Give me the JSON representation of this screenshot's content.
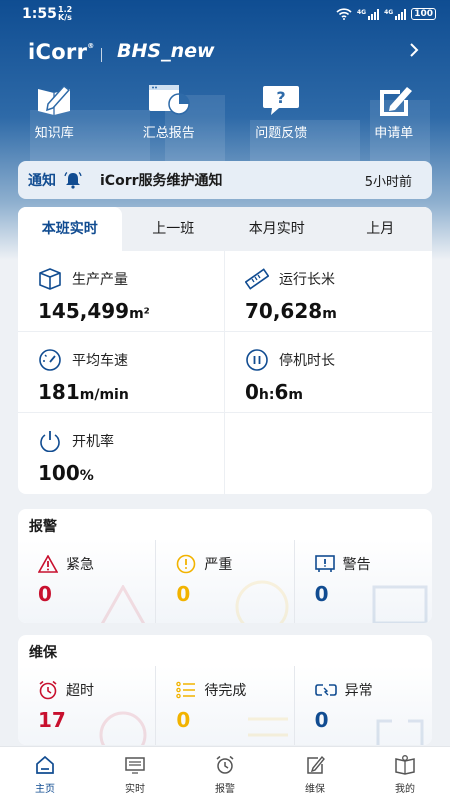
{
  "status_bar": {
    "time": "1:55",
    "net_speed_value": "1.2",
    "net_speed_unit": "K/s",
    "sim1": "4G",
    "sim2": "4G",
    "battery": "100"
  },
  "header": {
    "brand": "iCorr",
    "brand_mark": "®",
    "project": "BHS_new"
  },
  "quick_actions": [
    {
      "label": "知识库",
      "icon": "knowledge-base-icon"
    },
    {
      "label": "汇总报告",
      "icon": "report-chart-icon"
    },
    {
      "label": "问题反馈",
      "icon": "feedback-question-icon"
    },
    {
      "label": "申请单",
      "icon": "application-form-icon"
    }
  ],
  "notice": {
    "tag": "通知",
    "icon": "bell-icon",
    "text": "iCorr服务维护通知",
    "time": "5小时前"
  },
  "stats": {
    "tabs": [
      "本班实时",
      "上一班",
      "本月实时",
      "上月"
    ],
    "active_tab": 0,
    "items": [
      {
        "label": "生产产量",
        "value": "145,499",
        "unit": "m²",
        "icon": "box-icon"
      },
      {
        "label": "运行长米",
        "value": "70,628",
        "unit": "m",
        "icon": "ruler-icon"
      },
      {
        "label": "平均车速",
        "value": "181",
        "unit": "m/min",
        "icon": "speedometer-icon"
      },
      {
        "label": "停机时长",
        "value_h": "0",
        "unit_h": "h:",
        "value_m": "6",
        "unit_m": "m",
        "icon": "pause-icon"
      },
      {
        "label": "开机率",
        "value": "100",
        "unit": "%",
        "icon": "power-icon"
      }
    ]
  },
  "alarm": {
    "title": "报警",
    "items": [
      {
        "label": "紧急",
        "count": "0",
        "color": "#c8102e",
        "icon": "warning-triangle-icon"
      },
      {
        "label": "严重",
        "count": "0",
        "color": "#f2b300",
        "icon": "exclamation-circle-icon"
      },
      {
        "label": "警告",
        "count": "0",
        "color": "#114c91",
        "icon": "info-board-icon"
      }
    ]
  },
  "maintenance": {
    "title": "维保",
    "items": [
      {
        "label": "超时",
        "count": "17",
        "color": "#c8102e",
        "icon": "alarm-clock-icon"
      },
      {
        "label": "待完成",
        "count": "0",
        "color": "#f2b300",
        "icon": "todo-list-icon"
      },
      {
        "label": "异常",
        "count": "0",
        "color": "#114c91",
        "icon": "broken-link-icon"
      }
    ]
  },
  "tab_bar": [
    {
      "label": "主页",
      "icon": "home-icon",
      "active": true
    },
    {
      "label": "实时",
      "icon": "monitor-icon",
      "active": false
    },
    {
      "label": "报警",
      "icon": "alarm-bell-icon",
      "active": false
    },
    {
      "label": "维保",
      "icon": "edit-icon",
      "active": false
    },
    {
      "label": "我的",
      "icon": "profile-book-icon",
      "active": false
    }
  ],
  "colors": {
    "primary": "#114c91",
    "danger": "#c8102e",
    "warning": "#f2b300"
  }
}
